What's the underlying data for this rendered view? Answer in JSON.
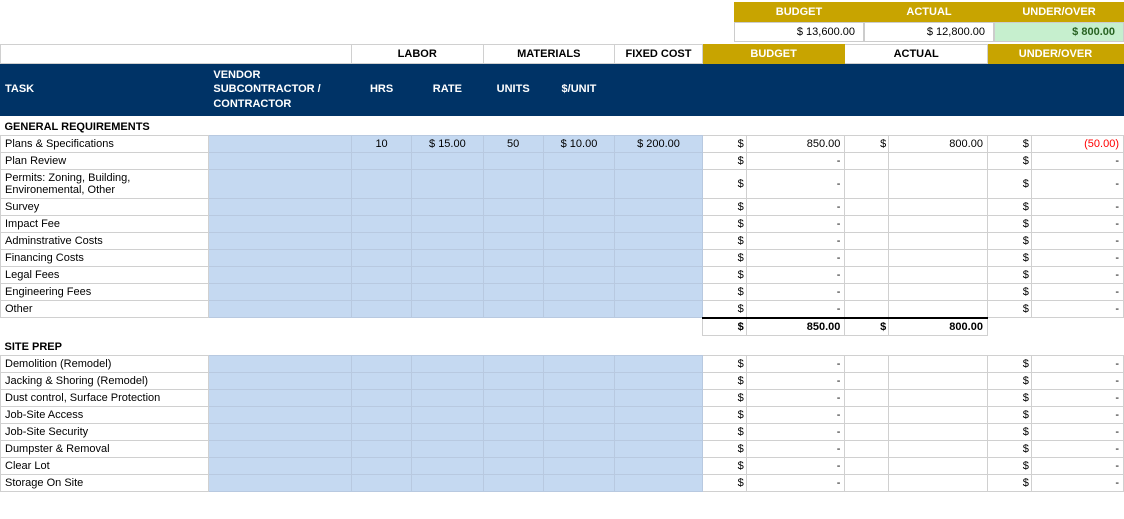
{
  "summary": {
    "labels": [
      "BUDGET",
      "ACTUAL",
      "UNDER/OVER"
    ],
    "values": [
      {
        "label": "BUDGET",
        "value": "$ 13,600.00"
      },
      {
        "label": "ACTUAL",
        "value": "$ 12,800.00"
      },
      {
        "label": "UNDER/OVER",
        "value": "$ 800.00",
        "type": "under"
      }
    ]
  },
  "col_groups": {
    "labor": "LABOR",
    "materials": "MATERIALS",
    "fixed_cost": "FIXED COST"
  },
  "columns": {
    "task": "TASK",
    "vendor": "VENDOR\nSUBCONTRACTOR /\nCONTRACTOR",
    "hrs": "HRS",
    "rate": "RATE",
    "units": "UNITS",
    "per_unit": "$/UNIT",
    "budget": "BUDGET",
    "actual": "ACTUAL",
    "underover": "UNDER/OVER"
  },
  "sections": [
    {
      "title": "GENERAL REQUIREMENTS",
      "rows": [
        {
          "task": "Plans & Specifications",
          "vendor": "",
          "hrs": "10",
          "rate": "$ 15.00",
          "units": "50",
          "per_unit": "$ 10.00",
          "fixed": "$ 200.00",
          "budget_dollar": "$",
          "budget": "850.00",
          "actual_dollar": "$",
          "actual": "800.00",
          "under_dollar": "$",
          "under": "(50.00)",
          "under_type": "neg"
        },
        {
          "task": "Plan Review",
          "vendor": "",
          "hrs": "",
          "rate": "",
          "units": "",
          "per_unit": "",
          "fixed": "",
          "budget_dollar": "$",
          "budget": "-",
          "actual_dollar": "",
          "actual": "",
          "under_dollar": "$",
          "under": "-"
        },
        {
          "task": "Permits: Zoning, Building, Environemental, Other",
          "vendor": "",
          "hrs": "",
          "rate": "",
          "units": "",
          "per_unit": "",
          "fixed": "",
          "budget_dollar": "$",
          "budget": "-",
          "actual_dollar": "",
          "actual": "",
          "under_dollar": "$",
          "under": "-"
        },
        {
          "task": "Survey",
          "vendor": "",
          "hrs": "",
          "rate": "",
          "units": "",
          "per_unit": "",
          "fixed": "",
          "budget_dollar": "$",
          "budget": "-",
          "actual_dollar": "",
          "actual": "",
          "under_dollar": "$",
          "under": "-"
        },
        {
          "task": "Impact Fee",
          "vendor": "",
          "hrs": "",
          "rate": "",
          "units": "",
          "per_unit": "",
          "fixed": "",
          "budget_dollar": "$",
          "budget": "-",
          "actual_dollar": "",
          "actual": "",
          "under_dollar": "$",
          "under": "-"
        },
        {
          "task": "Adminstrative Costs",
          "vendor": "",
          "hrs": "",
          "rate": "",
          "units": "",
          "per_unit": "",
          "fixed": "",
          "budget_dollar": "$",
          "budget": "-",
          "actual_dollar": "",
          "actual": "",
          "under_dollar": "$",
          "under": "-"
        },
        {
          "task": "Financing Costs",
          "vendor": "",
          "hrs": "",
          "rate": "",
          "units": "",
          "per_unit": "",
          "fixed": "",
          "budget_dollar": "$",
          "budget": "-",
          "actual_dollar": "",
          "actual": "",
          "under_dollar": "$",
          "under": "-"
        },
        {
          "task": "Legal Fees",
          "vendor": "",
          "hrs": "",
          "rate": "",
          "units": "",
          "per_unit": "",
          "fixed": "",
          "budget_dollar": "$",
          "budget": "-",
          "actual_dollar": "",
          "actual": "",
          "under_dollar": "$",
          "under": "-"
        },
        {
          "task": "Engineering Fees",
          "vendor": "",
          "hrs": "",
          "rate": "",
          "units": "",
          "per_unit": "",
          "fixed": "",
          "budget_dollar": "$",
          "budget": "-",
          "actual_dollar": "",
          "actual": "",
          "under_dollar": "$",
          "under": "-"
        },
        {
          "task": "Other",
          "vendor": "",
          "hrs": "",
          "rate": "",
          "units": "",
          "per_unit": "",
          "fixed": "",
          "budget_dollar": "$",
          "budget": "-",
          "actual_dollar": "",
          "actual": "",
          "under_dollar": "$",
          "under": "-"
        }
      ],
      "subtotal": {
        "budget_dollar": "$",
        "budget": "850.00",
        "actual_dollar": "$",
        "actual": "800.00"
      }
    },
    {
      "title": "SITE PREP",
      "rows": [
        {
          "task": "Demolition (Remodel)",
          "vendor": "",
          "hrs": "",
          "rate": "",
          "units": "",
          "per_unit": "",
          "fixed": "",
          "budget_dollar": "$",
          "budget": "-",
          "actual_dollar": "",
          "actual": "",
          "under_dollar": "$",
          "under": "-"
        },
        {
          "task": "Jacking & Shoring (Remodel)",
          "vendor": "",
          "hrs": "",
          "rate": "",
          "units": "",
          "per_unit": "",
          "fixed": "",
          "budget_dollar": "$",
          "budget": "-",
          "actual_dollar": "",
          "actual": "",
          "under_dollar": "$",
          "under": "-"
        },
        {
          "task": "Dust control, Surface Protection",
          "vendor": "",
          "hrs": "",
          "rate": "",
          "units": "",
          "per_unit": "",
          "fixed": "",
          "budget_dollar": "$",
          "budget": "-",
          "actual_dollar": "",
          "actual": "",
          "under_dollar": "$",
          "under": "-"
        },
        {
          "task": "Job-Site Access",
          "vendor": "",
          "hrs": "",
          "rate": "",
          "units": "",
          "per_unit": "",
          "fixed": "",
          "budget_dollar": "$",
          "budget": "-",
          "actual_dollar": "",
          "actual": "",
          "under_dollar": "$",
          "under": "-"
        },
        {
          "task": "Job-Site Security",
          "vendor": "",
          "hrs": "",
          "rate": "",
          "units": "",
          "per_unit": "",
          "fixed": "",
          "budget_dollar": "$",
          "budget": "-",
          "actual_dollar": "",
          "actual": "",
          "under_dollar": "$",
          "under": "-"
        },
        {
          "task": "Dumpster & Removal",
          "vendor": "",
          "hrs": "",
          "rate": "",
          "units": "",
          "per_unit": "",
          "fixed": "",
          "budget_dollar": "$",
          "budget": "-",
          "actual_dollar": "",
          "actual": "",
          "under_dollar": "$",
          "under": "-"
        },
        {
          "task": "Clear Lot",
          "vendor": "",
          "hrs": "",
          "rate": "",
          "units": "",
          "per_unit": "",
          "fixed": "",
          "budget_dollar": "$",
          "budget": "-",
          "actual_dollar": "",
          "actual": "",
          "under_dollar": "$",
          "under": "-"
        },
        {
          "task": "Storage On Site",
          "vendor": "",
          "hrs": "",
          "rate": "",
          "units": "",
          "per_unit": "",
          "fixed": "",
          "budget_dollar": "$",
          "budget": "-",
          "actual_dollar": "",
          "actual": "",
          "under_dollar": "$",
          "under": "-"
        }
      ]
    }
  ]
}
